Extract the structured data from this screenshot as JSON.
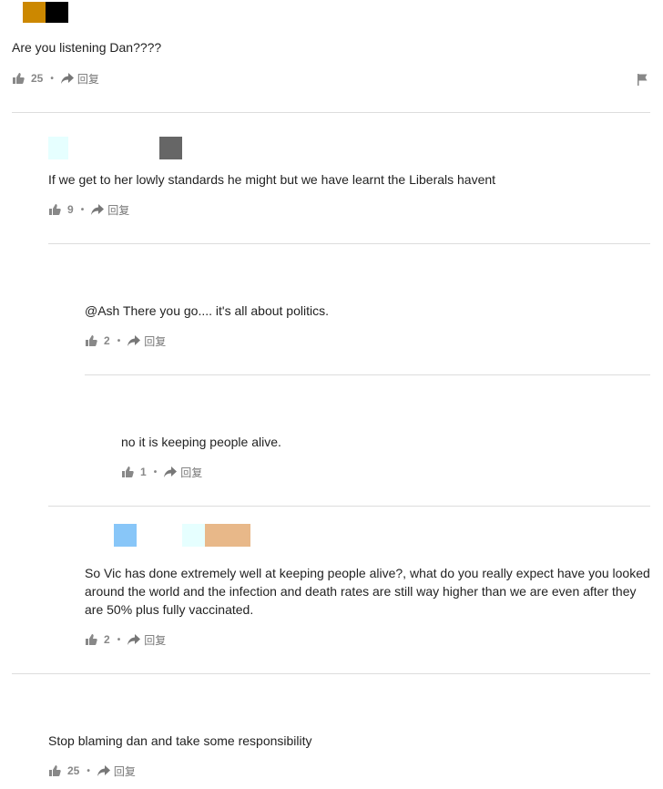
{
  "colors": {
    "text": "#222222",
    "meta": "#888888",
    "divider": "#dddddd",
    "avatar_blocks": [
      "#cc8800",
      "#000000",
      "#e6ffff",
      "#666666",
      "#88c6f8",
      "#e8b889"
    ]
  },
  "comments": [
    {
      "text": "Are you listening Dan????",
      "likes": "25",
      "reply_label": "回复"
    },
    {
      "text": "If we get to her lowly standards he might but we have learnt the Liberals havent",
      "likes": "9",
      "reply_label": "回复"
    },
    {
      "text": "@Ash There you go.... it's all about politics.",
      "likes": "2",
      "reply_label": "回复"
    },
    {
      "text": "no it is keeping people alive.",
      "likes": "1",
      "reply_label": "回复"
    },
    {
      "text": "So Vic has done extremely well at keeping people alive?, what do you really expect have you looked around the world and the infection and death rates are still way higher than we are even after they are 50% plus fully vaccinated.",
      "likes": "2",
      "reply_label": "回复"
    },
    {
      "text": "Stop blaming dan and take some responsibility",
      "likes": "25",
      "reply_label": "回复"
    }
  ],
  "icons": {
    "like": "thumbs-up-icon",
    "reply": "reply-arrow-icon",
    "flag": "flag-icon"
  }
}
